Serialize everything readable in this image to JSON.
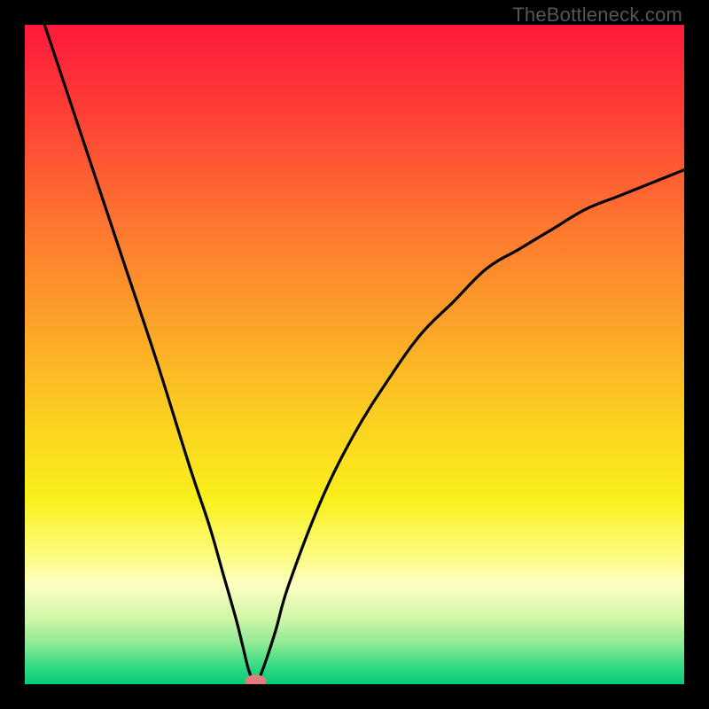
{
  "watermark": "TheBottleneck.com",
  "chart_data": {
    "type": "line",
    "title": "",
    "xlabel": "",
    "ylabel": "",
    "xlim": [
      0,
      100
    ],
    "ylim": [
      0,
      100
    ],
    "series": [
      {
        "name": "bottleneck-curve",
        "x": [
          3,
          5,
          10,
          15,
          20,
          25,
          28,
          30,
          32,
          33,
          34,
          35,
          36,
          38,
          40,
          45,
          50,
          55,
          60,
          65,
          70,
          75,
          80,
          85,
          90,
          95,
          100
        ],
        "y": [
          100,
          94,
          79,
          64,
          49,
          33,
          24,
          17,
          10,
          6,
          2,
          0,
          2,
          8,
          15,
          28,
          38,
          46,
          53,
          58,
          63,
          66,
          69,
          72,
          74,
          76,
          78
        ]
      }
    ],
    "gradient_stops": [
      {
        "offset": 0.0,
        "color": "#ff1a3a"
      },
      {
        "offset": 0.12,
        "color": "#ff3b37"
      },
      {
        "offset": 0.3,
        "color": "#fe7530"
      },
      {
        "offset": 0.45,
        "color": "#fca229"
      },
      {
        "offset": 0.6,
        "color": "#fbd121"
      },
      {
        "offset": 0.72,
        "color": "#f9f01b"
      },
      {
        "offset": 0.8,
        "color": "#fdfb7a"
      },
      {
        "offset": 0.85,
        "color": "#fdfec3"
      },
      {
        "offset": 0.9,
        "color": "#d0f6a8"
      },
      {
        "offset": 0.94,
        "color": "#8be994"
      },
      {
        "offset": 0.975,
        "color": "#2fd984"
      },
      {
        "offset": 1.0,
        "color": "#07c974"
      }
    ],
    "marker": {
      "name": "optimal-point",
      "x": 35,
      "y": 0.5,
      "color": "#e37d7d",
      "rx": 12,
      "ry": 7
    }
  }
}
